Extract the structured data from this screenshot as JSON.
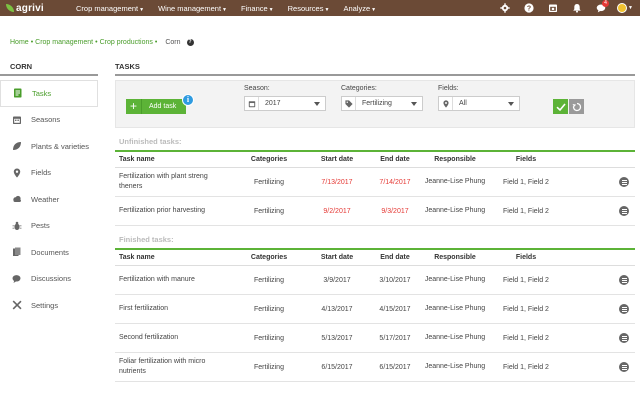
{
  "brand": {
    "name": "agrivi"
  },
  "nav": [
    {
      "label": "Crop management"
    },
    {
      "label": "Wine management"
    },
    {
      "label": "Finance"
    },
    {
      "label": "Resources"
    },
    {
      "label": "Analyze"
    }
  ],
  "top_icons": {
    "notifications_badge": "4"
  },
  "breadcrumb": {
    "items": [
      "Home",
      "Crop management",
      "Crop productions"
    ],
    "current": "Corn"
  },
  "sidebar": {
    "title": "CORN",
    "items": [
      {
        "label": "Tasks",
        "icon": "tasks-icon"
      },
      {
        "label": "Seasons",
        "icon": "calendar-icon"
      },
      {
        "label": "Plants & varieties",
        "icon": "leaf-icon"
      },
      {
        "label": "Fields",
        "icon": "map-pin-icon"
      },
      {
        "label": "Weather",
        "icon": "cloud-icon"
      },
      {
        "label": "Pests",
        "icon": "bug-icon"
      },
      {
        "label": "Documents",
        "icon": "documents-icon"
      },
      {
        "label": "Discussions",
        "icon": "chat-icon"
      },
      {
        "label": "Settings",
        "icon": "tools-icon"
      }
    ]
  },
  "main": {
    "title": "TASKS",
    "add_task_label": "Add task",
    "filters": {
      "season": {
        "label": "Season:",
        "value": "2017"
      },
      "categories": {
        "label": "Categories:",
        "value": "Fertilizing"
      },
      "fields": {
        "label": "Fields:",
        "value": "All"
      }
    },
    "columns": [
      "Task name",
      "Categories",
      "Start date",
      "End date",
      "Responsible",
      "Fields"
    ],
    "unfinished": {
      "label": "Unfinished tasks:",
      "rows": [
        {
          "name": "Fertilization with plant streng theners",
          "category": "Fertilizing",
          "start": "7/13/2017",
          "end": "7/14/2017",
          "responsible": "Jeanne-Lise Phung",
          "fields": "Field 1, Field 2"
        },
        {
          "name": "Fertilization prior harvesting",
          "category": "Fertilizing",
          "start": "9/2/2017",
          "end": "9/3/2017",
          "responsible": "Jeanne-Lise Phung",
          "fields": "Field 1, Field 2"
        }
      ]
    },
    "finished": {
      "label": "Finished tasks:",
      "rows": [
        {
          "name": "Fertilization with manure",
          "category": "Fertilizing",
          "start": "3/9/2017",
          "end": "3/10/2017",
          "responsible": "Jeanne-Lise Phung",
          "fields": "Field 1, Field 2"
        },
        {
          "name": "First fertilization",
          "category": "Fertilizing",
          "start": "4/13/2017",
          "end": "4/15/2017",
          "responsible": "Jeanne-Lise Phung",
          "fields": "Field 1, Field 2"
        },
        {
          "name": "Second fertilization",
          "category": "Fertilizing",
          "start": "5/13/2017",
          "end": "5/17/2017",
          "responsible": "Jeanne-Lise Phung",
          "fields": "Field 1, Field 2"
        },
        {
          "name": "Foliar fertilization with micro nutrients",
          "category": "Fertilizing",
          "start": "6/15/2017",
          "end": "6/15/2017",
          "responsible": "Jeanne-Lise Phung",
          "fields": "Field 1, Field 2"
        }
      ]
    }
  },
  "colors": {
    "brand_brown": "#6b4a36",
    "accent_green": "#5cb337",
    "overdue_red": "#e53935"
  }
}
